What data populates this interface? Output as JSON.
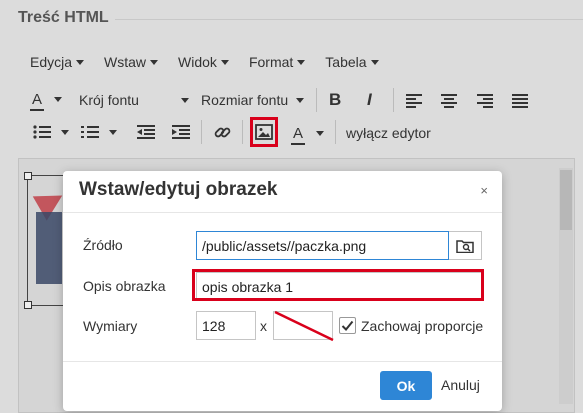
{
  "section": {
    "title": "Treść HTML"
  },
  "menubar": {
    "items": [
      {
        "label": "Edycja"
      },
      {
        "label": "Wstaw"
      },
      {
        "label": "Widok"
      },
      {
        "label": "Format"
      },
      {
        "label": "Tabela"
      }
    ]
  },
  "toolbar": {
    "font_family_label": "Krój fontu",
    "font_size_label": "Rozmiar fontu",
    "bold_label": "B",
    "italic_label": "I",
    "text_color_label": "A",
    "bg_color_label": "A",
    "toggle_editor_label": "wyłącz edytor"
  },
  "dialog": {
    "title": "Wstaw/edytuj obrazek",
    "close_label": "×",
    "source_label": "Źródło",
    "source_value": "/public/assets//paczka.png",
    "alt_label": "Opis obrazka",
    "alt_value": "opis obrazka 1",
    "dimensions_label": "Wymiary",
    "width_value": "128",
    "height_value": "",
    "dimension_separator": "x",
    "keep_ratio_label": "Zachowaj proporcje",
    "keep_ratio_checked": true,
    "ok_label": "Ok",
    "cancel_label": "Anuluj"
  },
  "colors": {
    "accent": "#2e86d6",
    "highlight": "#d9001b"
  }
}
